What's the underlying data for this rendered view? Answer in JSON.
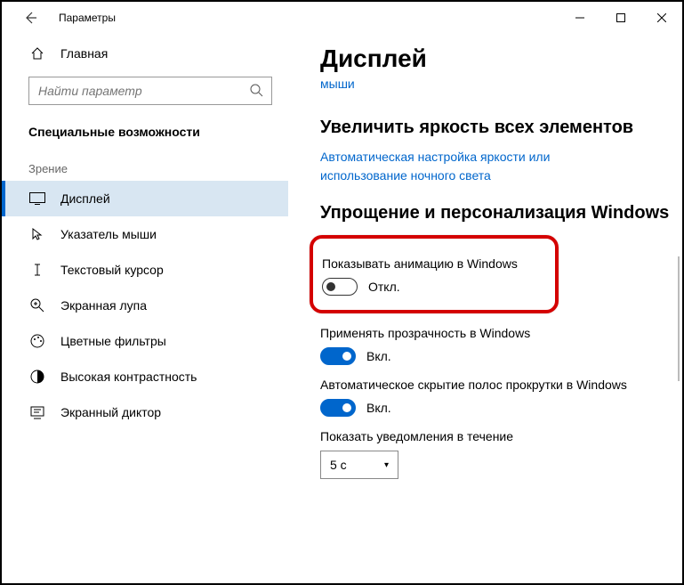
{
  "titlebar": {
    "title": "Параметры"
  },
  "sidebar": {
    "home": "Главная",
    "search_placeholder": "Найти параметр",
    "section": "Специальные возможности",
    "group": "Зрение",
    "items": [
      {
        "label": "Дисплей"
      },
      {
        "label": "Указатель мыши"
      },
      {
        "label": "Текстовый курсор"
      },
      {
        "label": "Экранная лупа"
      },
      {
        "label": "Цветные фильтры"
      },
      {
        "label": "Высокая контрастность"
      },
      {
        "label": "Экранный диктор"
      }
    ]
  },
  "main": {
    "heading": "Дисплей",
    "link_fragment": "мыши",
    "section1": {
      "title": "Увеличить яркость всех элементов",
      "link": "Автоматическая настройка яркости или использование ночного света"
    },
    "section2": {
      "title": "Упрощение и персонализация Windows",
      "s1": {
        "label": "Показывать анимацию в Windows",
        "state": "Откл."
      },
      "s2": {
        "label": "Применять прозрачность в Windows",
        "state": "Вкл."
      },
      "s3": {
        "label": "Автоматическое скрытие полос прокрутки в Windows",
        "state": "Вкл."
      },
      "s4": {
        "label": "Показать уведомления в течение",
        "value": "5 с"
      }
    }
  }
}
